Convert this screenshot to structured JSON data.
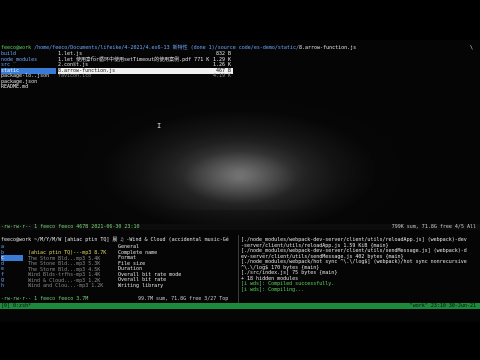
{
  "header": {
    "host": "feeco@work",
    "path": " /home/feeco/Documents/lifeike/4-2021/4.es6-13 新特性 (done 1)/source code/es-demo/static/",
    "file": "8.arrow-function.js",
    "backslash": "\\"
  },
  "fm": {
    "left": [
      {
        "name": "build",
        "cls": "blue"
      },
      {
        "name": "node_modules",
        "cls": "blue"
      },
      {
        "name": "src",
        "cls": "blue"
      },
      {
        "name": "static",
        "cls": "sel"
      },
      {
        "name": "package-lo..json",
        "cls": "white"
      },
      {
        "name": "package.json",
        "cls": "white"
      },
      {
        "name": "README.md",
        "cls": "white"
      }
    ],
    "mid": [
      {
        "name": "1.let.js",
        "size": "832 B",
        "cls": "white"
      },
      {
        "name": "1.let_使用案例.html",
        "size": "1.29 K",
        "cls": "white"
      },
      {
        "name": "2.const.js",
        "size": "1.26 K",
        "cls": "white"
      },
      {
        "name": "8.arrow-function.js",
        "size": "467 B",
        "cls": "sel2"
      },
      {
        "name": "favicon.ico",
        "size": "4.19 K",
        "cls": "gray"
      }
    ],
    "mid_extra": "for循环中使用setTimeout的使用案例.pdf 771 K"
  },
  "status_top": {
    "left": "-rw-rw-r-- 1 feeco feeco 467B 2021-06-30 23:10",
    "right": "799K sum, 71.8G free  4/5  All"
  },
  "music": {
    "header": "feeco@work ~/M/Y/M/W [ahiac ptin TQ] 晨 ♫ -Wind & Cloud (accidental music-Gé",
    "side": [
      "a",
      "b",
      "c",
      "d",
      "e",
      "f",
      "g",
      "h"
    ],
    "left_rows": [
      {
        "text": "(ahiac ptin TQ)---mp3 8.7K",
        "cls": "yellow"
      },
      {
        "text": "The Storm Bld...mp3 5.4K",
        "cls": "gray"
      },
      {
        "text": "The Stone Bld...mp3 5.3K",
        "cls": "gray"
      },
      {
        "text": "The Storm Bld...mp3 4.5K",
        "cls": "gray"
      },
      {
        "text": "Wind Blds-trfhs-mp3 1.4K",
        "cls": "gray"
      },
      {
        "text": "Wind & Cloud...-mp3 1.2K",
        "cls": "gray"
      },
      {
        "text": "Wind and Clou...-mp3 1.2K",
        "cls": "gray"
      }
    ],
    "info": [
      "General",
      "Complete name",
      "Format",
      "File size",
      "Duration",
      "Overall bit rate mode",
      "Overall bit rate",
      "Writing library"
    ],
    "status": "-rw-rw-r-- 1 feeco feeco 3.7M",
    "status_right": "99.7M sum, 71.8G free  3/27  Top"
  },
  "webpack": [
    {
      "text": "[./node_modules/webpack-dev-server/client/utils/reloadApp.js] (webpack)-dev",
      "cls": "white"
    },
    {
      "text": "-server/client/utils/reloadApp.js 1.59 KiB {main}",
      "cls": "white"
    },
    {
      "text": "[./node_modules/webpack-dev-server/client/utils/sendMessage.js] (webpack)-d",
      "cls": "white"
    },
    {
      "text": "ev-server/client/utils/sendMessage.js 402 bytes {main}",
      "cls": "white"
    },
    {
      "text": "[./node_modules/webpack/hot sync ^\\.\\/log$] (webpack)/hot sync nonrecursive",
      "cls": "white"
    },
    {
      "text": " ^\\.\\/log$ 170 bytes {main}",
      "cls": "white"
    },
    {
      "text": "[./src/index.js] 75 bytes {main}",
      "cls": "white"
    },
    {
      "text": "    + 18 hidden modules",
      "cls": "white"
    },
    {
      "text": "[i wds]: Compiled successfully.",
      "cls": "green"
    },
    {
      "text": "[i wds]: Compiling...",
      "cls": "green"
    }
  ],
  "tmux": {
    "left": "[0] 0:zsh*",
    "right": "\"work\" 23:10 30-Jun-21"
  },
  "colors": {
    "tmux_bar": "#1c8a3a",
    "accent_blue": "#3a7bd5"
  }
}
